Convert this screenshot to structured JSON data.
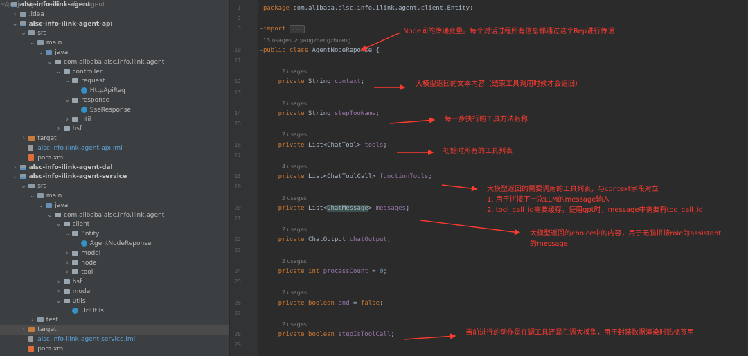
{
  "tree": [
    {
      "label": "alsc-info-ilink-agent",
      "path": "~/project/yzz/alsc-info-ilink-agent",
      "indent": 0,
      "open": true,
      "icon": "module-folder-icon",
      "bold": true
    },
    {
      "label": ".idea",
      "indent": 1,
      "open": false,
      "icon": "folder-icon"
    },
    {
      "label": "alsc-info-ilink-agent-api",
      "indent": 1,
      "open": true,
      "icon": "module-folder-icon",
      "bold": true
    },
    {
      "label": "src",
      "indent": 2,
      "open": true,
      "icon": "folder-icon"
    },
    {
      "label": "main",
      "indent": 3,
      "open": true,
      "icon": "folder-icon"
    },
    {
      "label": "java",
      "indent": 4,
      "open": true,
      "icon": "source-folder-icon"
    },
    {
      "label": "com.alibaba.alsc.info.ilink.agent",
      "indent": 5,
      "open": true,
      "icon": "package-icon"
    },
    {
      "label": "controller",
      "indent": 6,
      "open": true,
      "icon": "package-icon"
    },
    {
      "label": "request",
      "indent": 7,
      "open": true,
      "icon": "package-icon"
    },
    {
      "label": "HttpApiReq",
      "indent": 8,
      "icon": "class-icon"
    },
    {
      "label": "response",
      "indent": 7,
      "open": true,
      "icon": "package-icon"
    },
    {
      "label": "SseResponse",
      "indent": 8,
      "icon": "class-icon"
    },
    {
      "label": "util",
      "indent": 7,
      "open": false,
      "icon": "package-icon"
    },
    {
      "label": "hsf",
      "indent": 6,
      "open": false,
      "icon": "package-icon"
    },
    {
      "label": "target",
      "indent": 2,
      "open": false,
      "icon": "target-folder-icon"
    },
    {
      "label": "alsc-info-ilink-agent-api.iml",
      "indent": 2,
      "icon": "iml-file-icon",
      "blue": true
    },
    {
      "label": "pom.xml",
      "indent": 2,
      "icon": "maven-file-icon"
    },
    {
      "label": "alsc-info-ilink-agent-dal",
      "indent": 1,
      "open": false,
      "icon": "module-folder-icon",
      "bold": true
    },
    {
      "label": "alsc-info-ilink-agent-service",
      "indent": 1,
      "open": true,
      "icon": "module-folder-icon",
      "bold": true
    },
    {
      "label": "src",
      "indent": 2,
      "open": true,
      "icon": "folder-icon"
    },
    {
      "label": "main",
      "indent": 3,
      "open": true,
      "icon": "folder-icon"
    },
    {
      "label": "java",
      "indent": 4,
      "open": true,
      "icon": "source-folder-icon"
    },
    {
      "label": "com.alibaba.alsc.info.ilink.agent",
      "indent": 5,
      "open": true,
      "icon": "package-icon"
    },
    {
      "label": "client",
      "indent": 6,
      "open": true,
      "icon": "package-icon"
    },
    {
      "label": "Entity",
      "indent": 7,
      "open": true,
      "icon": "package-icon"
    },
    {
      "label": "AgentNodeReponse",
      "indent": 8,
      "icon": "class-icon"
    },
    {
      "label": "model",
      "indent": 7,
      "open": false,
      "icon": "package-icon"
    },
    {
      "label": "node",
      "indent": 7,
      "open": false,
      "icon": "package-icon"
    },
    {
      "label": "tool",
      "indent": 7,
      "open": false,
      "icon": "package-icon"
    },
    {
      "label": "hsf",
      "indent": 6,
      "open": false,
      "icon": "package-icon"
    },
    {
      "label": "model",
      "indent": 6,
      "open": false,
      "icon": "package-icon"
    },
    {
      "label": "utils",
      "indent": 6,
      "open": true,
      "icon": "package-icon"
    },
    {
      "label": "UrlUtils",
      "indent": 7,
      "icon": "class-icon"
    },
    {
      "label": "test",
      "indent": 3,
      "open": false,
      "icon": "folder-icon"
    },
    {
      "label": "target",
      "indent": 2,
      "open": false,
      "icon": "target-folder-icon",
      "selected": true
    },
    {
      "label": "alsc-info-ilink-agent-service.iml",
      "indent": 2,
      "icon": "iml-file-icon",
      "blue": true
    },
    {
      "label": "pom.xml",
      "indent": 2,
      "icon": "maven-file-icon"
    }
  ],
  "editor": {
    "lines": [
      {
        "ln": "1",
        "tokens": [
          [
            "kw",
            "package "
          ],
          [
            "n",
            "com.alibaba.alsc.info.ilink.agent.client.Entity;"
          ]
        ]
      },
      {
        "ln": "2"
      },
      {
        "ln": "3",
        "tokens": [
          [
            "kw",
            "import "
          ],
          [
            "box",
            "..."
          ]
        ]
      },
      {
        "ln": "",
        "usage": "13 usages   ↗ yangzhengzhuang"
      },
      {
        "ln": "10",
        "tokens": [
          [
            "kw",
            "public class "
          ],
          [
            "n",
            "AgentNodeReponse {"
          ]
        ]
      },
      {
        "ln": "11"
      },
      {
        "ln": "",
        "usage": "2 usages",
        "ui": true
      },
      {
        "ln": "12",
        "tokens": [
          [
            "kw",
            "    private "
          ],
          [
            "n",
            "String "
          ],
          [
            "f",
            "context"
          ],
          [
            "n",
            ";"
          ]
        ]
      },
      {
        "ln": "13"
      },
      {
        "ln": "",
        "usage": "2 usages",
        "ui": true
      },
      {
        "ln": "14",
        "tokens": [
          [
            "kw",
            "    private "
          ],
          [
            "n",
            "String "
          ],
          [
            "f",
            "stepTooName"
          ],
          [
            "n",
            ";"
          ]
        ]
      },
      {
        "ln": "15"
      },
      {
        "ln": "",
        "usage": "2 usages",
        "ui": true
      },
      {
        "ln": "16",
        "tokens": [
          [
            "kw",
            "    private "
          ],
          [
            "n",
            "List<ChatTool> "
          ],
          [
            "f",
            "tools"
          ],
          [
            "n",
            ";"
          ]
        ]
      },
      {
        "ln": "17"
      },
      {
        "ln": "",
        "usage": "4 usages",
        "ui": true
      },
      {
        "ln": "18",
        "tokens": [
          [
            "kw",
            "    private "
          ],
          [
            "n",
            "List<ChatToolCall> "
          ],
          [
            "f",
            "functionTools"
          ],
          [
            "n",
            ";"
          ]
        ]
      },
      {
        "ln": "19"
      },
      {
        "ln": "",
        "usage": "2 usages",
        "ui": true
      },
      {
        "ln": "20",
        "tokens": [
          [
            "kw",
            "    private "
          ],
          [
            "n",
            "List<"
          ],
          [
            "hl",
            "ChatMessage"
          ],
          [
            "n",
            "> "
          ],
          [
            "f",
            "messages"
          ],
          [
            "n",
            ";"
          ]
        ]
      },
      {
        "ln": "21"
      },
      {
        "ln": "",
        "usage": "2 usages",
        "ui": true
      },
      {
        "ln": "22",
        "tokens": [
          [
            "kw",
            "    private "
          ],
          [
            "n",
            "ChatOutput "
          ],
          [
            "f",
            "chatOutput"
          ],
          [
            "n",
            ";"
          ]
        ]
      },
      {
        "ln": "23"
      },
      {
        "ln": "",
        "usage": "2 usages",
        "ui": true
      },
      {
        "ln": "24",
        "tokens": [
          [
            "kw",
            "    private int "
          ],
          [
            "f",
            "processCount"
          ],
          [
            "n",
            " = "
          ],
          [
            "num",
            "0"
          ],
          [
            "n",
            ";"
          ]
        ]
      },
      {
        "ln": "25"
      },
      {
        "ln": "",
        "usage": "2 usages",
        "ui": true
      },
      {
        "ln": "26",
        "tokens": [
          [
            "kw",
            "    private boolean "
          ],
          [
            "f",
            "end"
          ],
          [
            "n",
            " = "
          ],
          [
            "kw",
            "false"
          ],
          [
            "n",
            ";"
          ]
        ]
      },
      {
        "ln": "27"
      },
      {
        "ln": "",
        "usage": "2 usages",
        "ui": true
      },
      {
        "ln": "28",
        "tokens": [
          [
            "kw",
            "    private boolean "
          ],
          [
            "f",
            "stepIsToolCall"
          ],
          [
            "n",
            ";"
          ]
        ]
      },
      {
        "ln": "29"
      }
    ]
  },
  "annotations": [
    {
      "text": "Node间的传递变量。每个对话过程所有信息都通过这个Rep进行传递"
    },
    {
      "text": "大模型返回的文本内容（结束工具调用时候才会返回）"
    },
    {
      "text": "每一步执行的工具方法名称"
    },
    {
      "text": "初始时所有的工具列表"
    },
    {
      "text": "大模型返回的需要调用的工具列表，与context字段对立"
    },
    {
      "text": "1. 用于拼接下一次LLM的message输入"
    },
    {
      "text": "2. tool_call_id需要缓存，使用gpt时，message中需要有too_call_id"
    },
    {
      "text": "大模型返回的choice中的内容，用于无脑拼接role为assistant"
    },
    {
      "text": "的message"
    },
    {
      "text": "当前进行的动作是在调工具还是在调大模型，用于封装数据渲染时贴标签用"
    }
  ],
  "colors": {
    "annotation": "#ff3b30",
    "keyword": "#cc7832",
    "field": "#9876aa",
    "number": "#6897bb",
    "text": "#a9b7c6"
  }
}
